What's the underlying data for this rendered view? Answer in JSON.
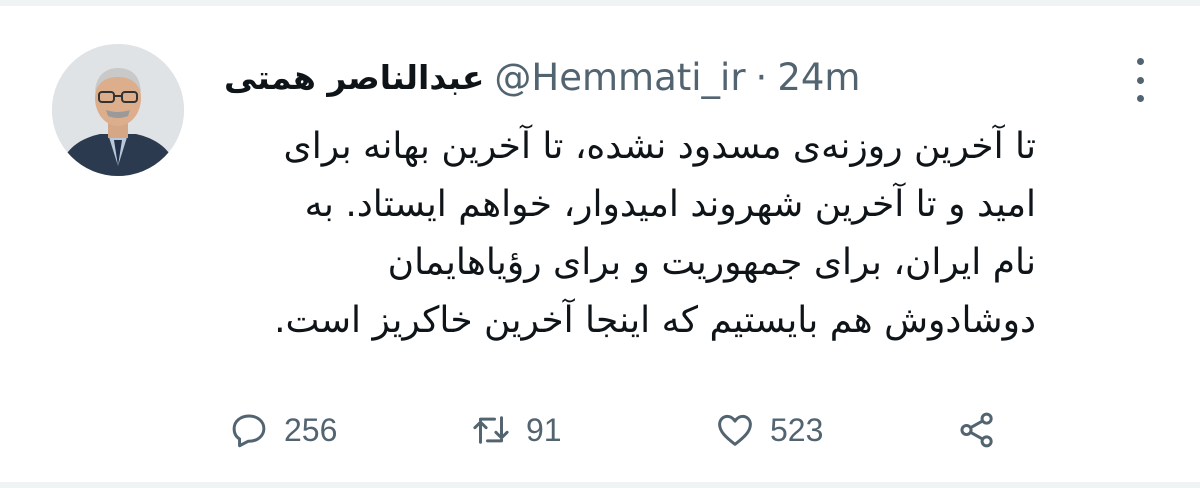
{
  "tweet": {
    "author": {
      "display_name": "عبدالناصر همتی",
      "handle": "@Hemmati_ir",
      "avatar_icon": "profile-photo"
    },
    "separator": "·",
    "time": "24m",
    "text_lines": [
      "تا آخرین روزنه‌ی مسدود نشده، تا آخرین بهانه برای",
      "امید و تا آخرین شهروند امیدوار، خواهم ایستاد. به",
      "نام ایران، برای جمهوریت و برای رؤیاهایمان",
      "دوشادوش هم بایستیم که اینجا آخرین خاکریز است."
    ],
    "actions": {
      "reply": {
        "icon": "reply-icon",
        "count": "256"
      },
      "retweet": {
        "icon": "retweet-icon",
        "count": "91"
      },
      "like": {
        "icon": "heart-icon",
        "count": "523"
      },
      "share": {
        "icon": "share-icon"
      }
    },
    "more_icon": "more-icon"
  },
  "colors": {
    "text": "#0f1419",
    "secondary": "#536471",
    "divider": "#eff3f4"
  }
}
